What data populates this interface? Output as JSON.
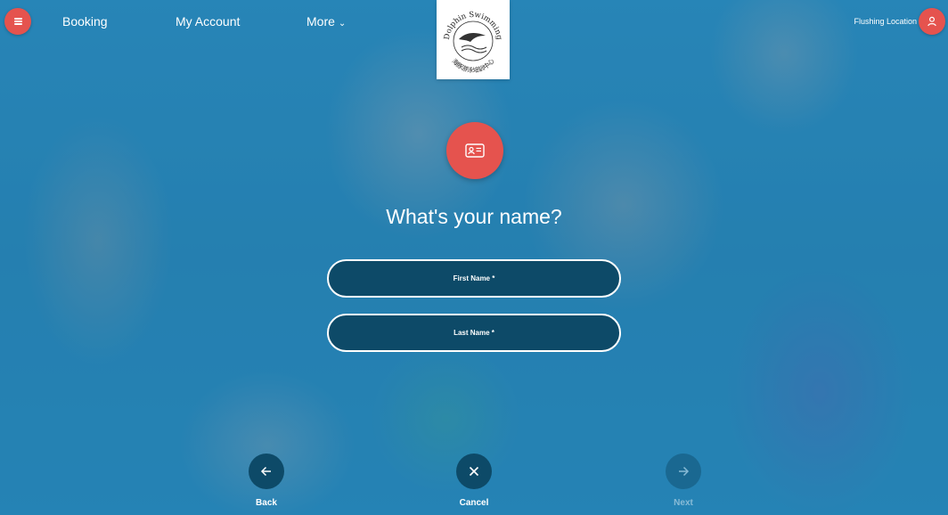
{
  "nav": {
    "booking": "Booking",
    "my_account": "My Account",
    "more": "More",
    "location": "Flushing Location"
  },
  "logo": {
    "text_en": "Dolphin Swimming",
    "text_zh": "海豚游泳培訓中心"
  },
  "form": {
    "question": "What's your name?",
    "first_name_label": "First Name *",
    "last_name_label": "Last Name *"
  },
  "controls": {
    "back": "Back",
    "cancel": "Cancel",
    "next": "Next"
  },
  "icons": {
    "menu": "hamburger-menu-icon",
    "user": "user-icon",
    "id_card": "id-card-icon",
    "back": "arrow-left-icon",
    "cancel": "close-icon",
    "next": "arrow-right-icon"
  },
  "colors": {
    "accent": "#e5534e",
    "field_bg": "#0d4a68",
    "overlay": "#2a8cba"
  }
}
